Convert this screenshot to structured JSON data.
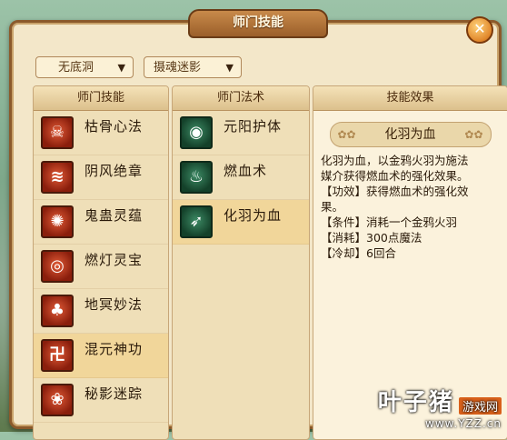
{
  "window": {
    "title": "师门技能"
  },
  "filters": {
    "dropdown1": "无底洞",
    "dropdown2": "摄魂迷影"
  },
  "columns": {
    "skills": "师门技能",
    "spells": "师门法术",
    "effect": "技能效果"
  },
  "skills": [
    {
      "label": "枯骨心法",
      "icon": "bones-icon"
    },
    {
      "label": "阴风绝章",
      "icon": "wind-icon"
    },
    {
      "label": "鬼蛊灵蕴",
      "icon": "scorpion-icon"
    },
    {
      "label": "燃灯灵宝",
      "icon": "lantern-icon"
    },
    {
      "label": "地冥妙法",
      "icon": "tree-icon"
    },
    {
      "label": "混元神功",
      "icon": "swirl-icon"
    },
    {
      "label": "秘影迷踪",
      "icon": "pattern-icon"
    }
  ],
  "selected_skill_index": 5,
  "spells": [
    {
      "label": "元阳护体",
      "icon": "spiral-icon"
    },
    {
      "label": "燃血术",
      "icon": "flame-icon"
    },
    {
      "label": "化羽为血",
      "icon": "feather-icon"
    }
  ],
  "selected_spell_index": 2,
  "effect": {
    "name": "化羽为血",
    "lines": [
      "化羽为血，以金鸦火羽为施法",
      "媒介获得燃血术的强化效果。",
      "【功效】获得燃血术的强化效",
      "果。",
      "【条件】消耗一个金鸦火羽",
      "【消耗】300点魔法",
      "【冷却】6回合"
    ]
  },
  "watermark": {
    "main": "叶子猪",
    "badge": "游戏网",
    "sub": "www.YZZ.cn"
  }
}
